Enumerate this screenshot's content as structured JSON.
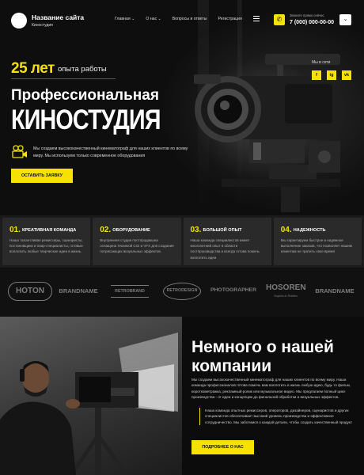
{
  "header": {
    "site_title": "Название сайта",
    "site_subtitle": "Киностудия",
    "nav": [
      "Главная",
      "О нас",
      "Вопросы и ответы",
      "Регистрация"
    ],
    "phone_label": "Звоните прямо сейчас",
    "phone": "7 (000) 000-00-00"
  },
  "hero": {
    "years": "25 лет",
    "years_text": "опыта работы",
    "headline_line1": "Профессиональная",
    "headline_line2": "КИНОСТУДИЯ",
    "description": "Мы создаем высококачественный кинематограф для наших клиентов по всему миру. Мы используем только современное оборудования",
    "cta": "ОСТАВИТЬ ЗАЯВКУ",
    "social_label": "Мы в сети",
    "social": [
      "f",
      "ig",
      "vk"
    ]
  },
  "features": [
    {
      "num": "01.",
      "title": "КРЕАТИВНАЯ КОМАНДА",
      "text": "Наша талантливая режиссеры, сценаристы, постановщики и пиар-специалисты, готовые воплотить любые творческие идеи в жизнь."
    },
    {
      "num": "02.",
      "title": "ОБОРУДОВАНИЕ",
      "text": "Внутренняя студия постпродакшна оснащена техникой CGI и VFX для создания потрясающих визуальных эффектов."
    },
    {
      "num": "03.",
      "title": "БОЛЬШОЙ ОПЫТ",
      "text": "Наша команда специалистов имеет многолетний опыт в области постпроизводства и всегда готова помочь воплотить идеи"
    },
    {
      "num": "04.",
      "title": "НАДЕЖНОСТЬ",
      "text": "Мы гарантируем быстрое и надежное выполнение заказов, что позволяет нашим клиентам не тратить свое время"
    }
  ],
  "brands": [
    "HOTON",
    "BRANDNAME",
    "RETROBRAND",
    "RETRODESIGN",
    "PHOTOGRAPHER",
    "HOSOREN",
    "BRANDNAME"
  ],
  "brand_taglines": {
    "hosoren": "Sophia & Robles"
  },
  "about": {
    "title": "Немного о нашей компании",
    "paragraph": "Мы создаем высококачественный кинематограф для наших клиентов по всему миру. Наша команда профессионалов готова помочь вам воплотить в жизнь любую идею, будь то фильм, короткометражка, рекламный ролик или музыкальное видео. Мы предлагаем полный цикл производства - от идеи и концепции до финальной обработки и визуальных эффектов.",
    "quote": "Наша команда опытных режиссеров, операторов, дизайнеров, сценаристов и других специалистов обеспечивает высокий уровень производства и эффективное сотрудничество. Мы заботимся о каждой детали, чтобы создать качественный продукт",
    "button": "ПОДРОБНЕЕ О НАС"
  },
  "colors": {
    "accent": "#f5e200",
    "background": "#0d0d0d",
    "card": "#2a2a2a"
  }
}
